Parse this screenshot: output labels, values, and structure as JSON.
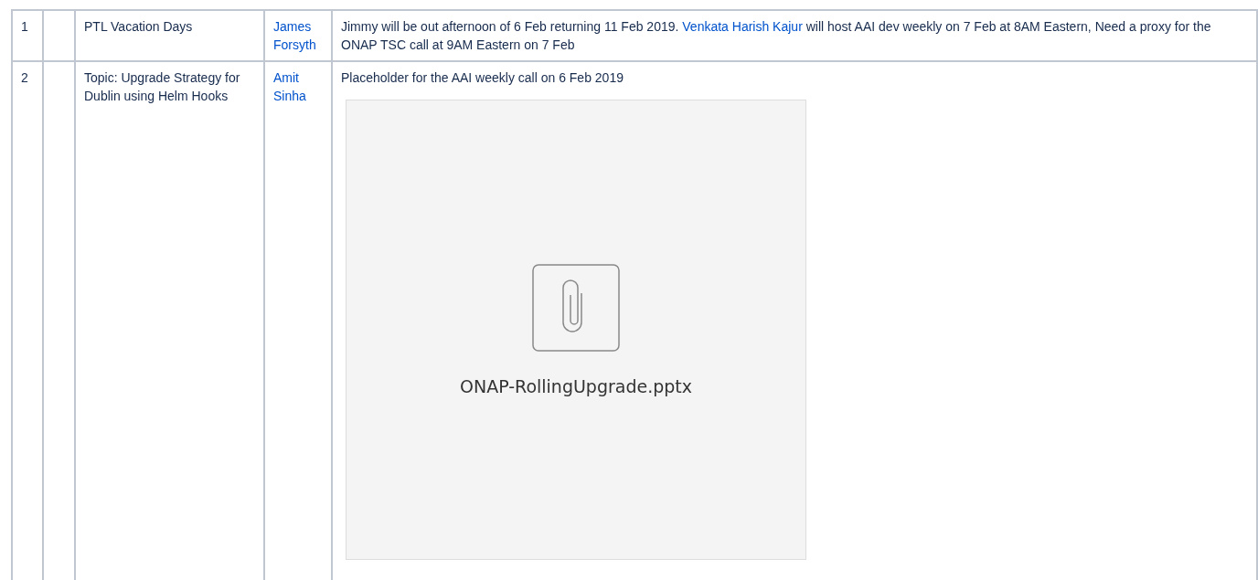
{
  "rows": [
    {
      "number": "1",
      "column_2": "",
      "item": "PTL Vacation Days",
      "owner": "James Forsyth",
      "notes": [
        {
          "kind": "text",
          "text": "Jimmy will be out afternoon of 6 Feb returning 11 Feb 2019. "
        },
        {
          "kind": "mention",
          "text": "Venkata Harish Kajur"
        },
        {
          "kind": "text",
          "text": " will host AAI dev weekly on 7 Feb at 8AM Eastern, Need a proxy for the ONAP TSC call at 9AM Eastern on 7 Feb"
        }
      ]
    },
    {
      "number": "2",
      "column_2": "",
      "item": "Topic: Upgrade Strategy for Dublin using Helm Hooks",
      "owner": "Amit Sinha",
      "notes": [
        {
          "kind": "text",
          "text": "Placeholder for the AAI weekly call on 6 Feb 2019"
        }
      ],
      "attachment": {
        "filename": "ONAP-RollingUpgrade.pptx"
      }
    }
  ]
}
